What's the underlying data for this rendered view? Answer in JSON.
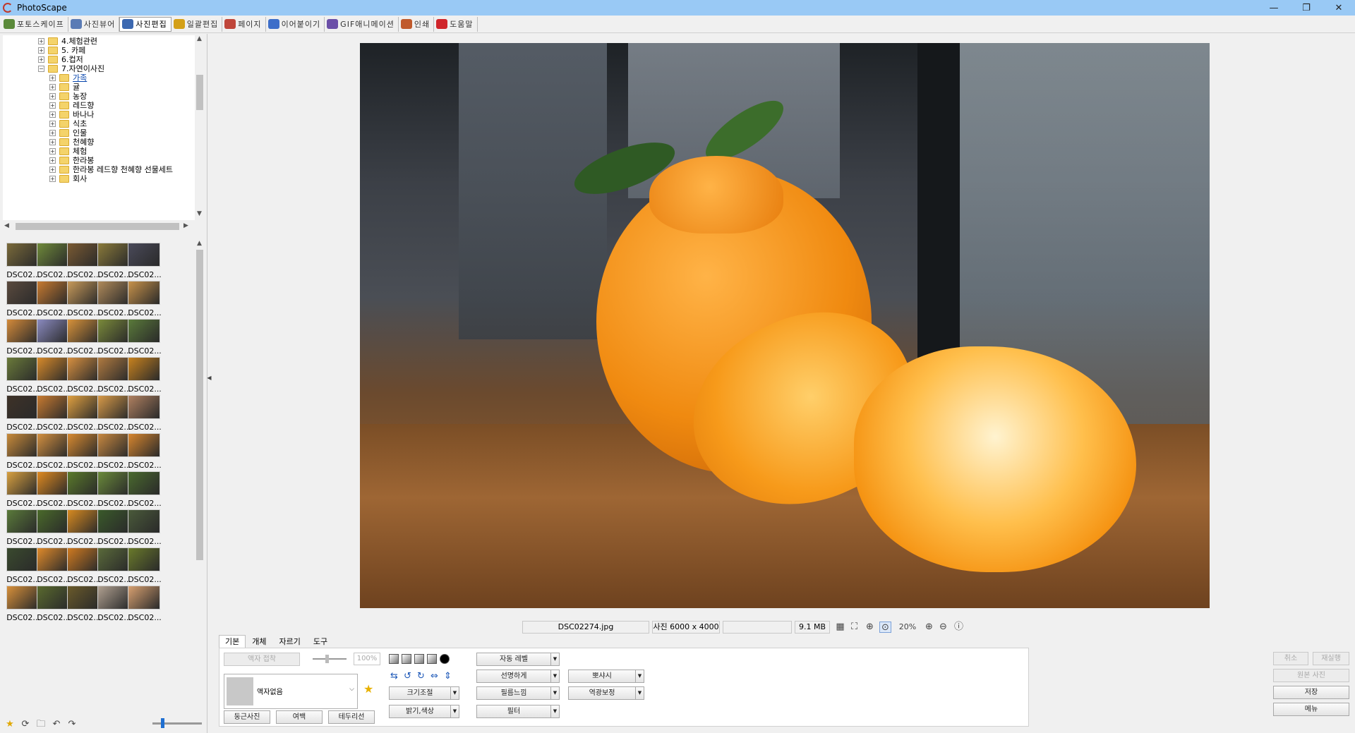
{
  "window": {
    "title": "PhotoScape",
    "minimize": "—",
    "maximize": "❐",
    "close": "✕"
  },
  "tabs": [
    {
      "label": "포토스케이프",
      "color": "#5b8a3a"
    },
    {
      "label": "사진뷰어",
      "color": "#5a7bb5"
    },
    {
      "label": "사진편집",
      "color": "#3c68b0",
      "active": true
    },
    {
      "label": "일괄편집",
      "color": "#d4a017"
    },
    {
      "label": "페이지",
      "color": "#c0463a"
    },
    {
      "label": "이어붙이기",
      "color": "#3d6ec9"
    },
    {
      "label": "GIF애니메이션",
      "color": "#6b4fa8"
    },
    {
      "label": "인쇄",
      "color": "#c05a2c"
    },
    {
      "label": "도움말",
      "color": "#d0262b"
    }
  ],
  "tree": {
    "items": [
      {
        "label": "4.체험관련",
        "level": 0,
        "expanded": false
      },
      {
        "label": "5. 카페",
        "level": 0,
        "expanded": false
      },
      {
        "label": "6.컵저",
        "level": 0,
        "expanded": false
      },
      {
        "label": "7.자연이사진",
        "level": 0,
        "expanded": true
      },
      {
        "label": "가족",
        "level": 1,
        "selected": true
      },
      {
        "label": "귤",
        "level": 1
      },
      {
        "label": "농장",
        "level": 1
      },
      {
        "label": "레드향",
        "level": 1
      },
      {
        "label": "바나나",
        "level": 1
      },
      {
        "label": "식초",
        "level": 1
      },
      {
        "label": "인물",
        "level": 1
      },
      {
        "label": "천혜향",
        "level": 1
      },
      {
        "label": "체험",
        "level": 1
      },
      {
        "label": "한라봉",
        "level": 1
      },
      {
        "label": "한라봉 레드향 천혜향 선물세트",
        "level": 1
      },
      {
        "label": "회사",
        "level": 1
      }
    ]
  },
  "thumbnails": {
    "label": "DSC02...",
    "colors": [
      "#7a6a3a",
      "#6f8a3a",
      "#7a5a32",
      "#8a7a3a",
      "#4a4a5a",
      "#5a4a3e",
      "#c87a30",
      "#c89a5a",
      "#b08a5a",
      "#c8924a",
      "#d48a3a",
      "#8a8ac0",
      "#d8923a",
      "#7a8a3a",
      "#5a7a3a",
      "#6a7a3a",
      "#d88a2a",
      "#d89040",
      "#b07a40",
      "#c8821e",
      "#3e3228",
      "#c87a30",
      "#e0a040",
      "#d89a48",
      "#b08060",
      "#c88a3a",
      "#d49040",
      "#d88a30",
      "#c88840",
      "#d8862e",
      "#d8a040",
      "#e08a20",
      "#5a7a2a",
      "#6a8a3a",
      "#4a6a2e",
      "#5a7a3a",
      "#4a6a2a",
      "#d88a20",
      "#3a5a2a",
      "#4a5a3a",
      "#3a4a2e",
      "#e08a2a",
      "#d07a20",
      "#5a6a3a",
      "#6a7a2a",
      "#d8903a",
      "#5a6a2e",
      "#6a5a2a",
      "#b0a090",
      "#d8a070"
    ]
  },
  "status": {
    "filename": "DSC02274.jpg",
    "dimensions": "사진 6000 x 4000",
    "filesize": "9.1 MB",
    "zoom": "20%"
  },
  "bottom_tabs": [
    "기본",
    "개체",
    "자르기",
    "도구"
  ],
  "tools": {
    "frame_fit": "액자 접착",
    "frame_percent": "100%",
    "frame_name": "액자없음",
    "round_photo": "둥근사진",
    "margin": "여백",
    "border": "테두리선",
    "auto_level": "자동 레벨",
    "sharpen": "선명하게",
    "bloom": "뽀샤시",
    "resize": "크기조절",
    "film": "필름느낌",
    "backlight": "역광보정",
    "brightness": "밝기,색상",
    "filter": "필터"
  },
  "actions": {
    "undo": "취소",
    "redo": "재실행",
    "original": "원본 사진",
    "save": "저장",
    "menu": "메뉴"
  }
}
